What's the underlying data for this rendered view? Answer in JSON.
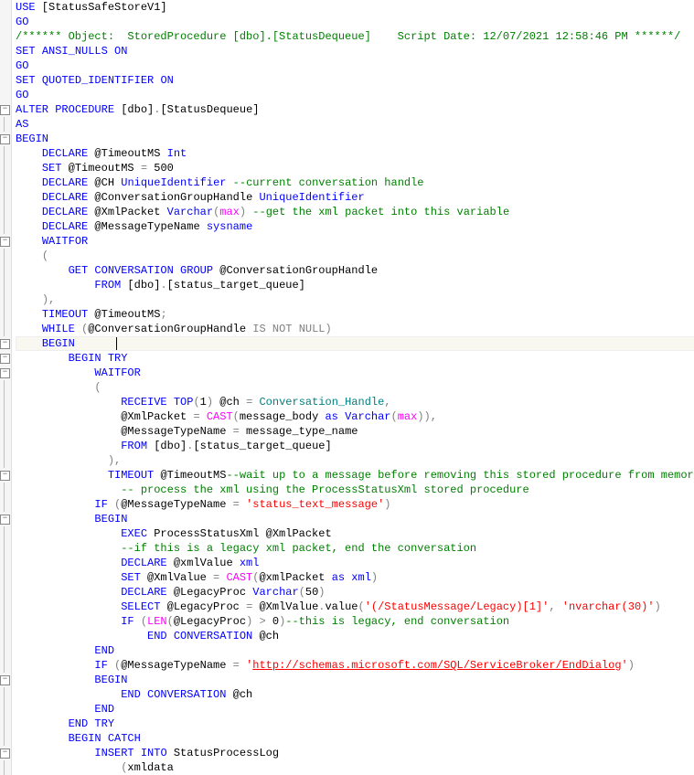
{
  "lines": [
    {
      "fold": "",
      "seg": [
        {
          "c": "kw",
          "t": "USE"
        },
        {
          "c": "txt",
          "t": " [StatusSafeStoreV1]"
        }
      ]
    },
    {
      "fold": "",
      "seg": [
        {
          "c": "kw",
          "t": "GO"
        }
      ]
    },
    {
      "fold": "",
      "seg": [
        {
          "c": "comment",
          "t": "/****** Object:  StoredProcedure [dbo].[StatusDequeue]    Script Date: 12/07/2021 12:58:46 PM ******/"
        }
      ]
    },
    {
      "fold": "",
      "seg": [
        {
          "c": "kw",
          "t": "SET"
        },
        {
          "c": "txt",
          "t": " "
        },
        {
          "c": "kw",
          "t": "ANSI_NULLS"
        },
        {
          "c": "txt",
          "t": " "
        },
        {
          "c": "kw",
          "t": "ON"
        }
      ]
    },
    {
      "fold": "",
      "seg": [
        {
          "c": "kw",
          "t": "GO"
        }
      ]
    },
    {
      "fold": "",
      "seg": [
        {
          "c": "kw",
          "t": "SET"
        },
        {
          "c": "txt",
          "t": " "
        },
        {
          "c": "kw",
          "t": "QUOTED_IDENTIFIER"
        },
        {
          "c": "txt",
          "t": " "
        },
        {
          "c": "kw",
          "t": "ON"
        }
      ]
    },
    {
      "fold": "",
      "seg": [
        {
          "c": "kw",
          "t": "GO"
        }
      ]
    },
    {
      "fold": "−",
      "seg": [
        {
          "c": "kw",
          "t": "ALTER"
        },
        {
          "c": "txt",
          "t": " "
        },
        {
          "c": "kw",
          "t": "PROCEDURE"
        },
        {
          "c": "txt",
          "t": " [dbo]"
        },
        {
          "c": "op",
          "t": "."
        },
        {
          "c": "txt",
          "t": "[StatusDequeue]"
        }
      ]
    },
    {
      "fold": "|",
      "seg": [
        {
          "c": "kw",
          "t": "AS"
        }
      ]
    },
    {
      "fold": "−",
      "seg": [
        {
          "c": "kw",
          "t": "BEGIN"
        }
      ]
    },
    {
      "fold": "|",
      "seg": [
        {
          "c": "txt",
          "t": "    "
        },
        {
          "c": "kw",
          "t": "DECLARE"
        },
        {
          "c": "txt",
          "t": " @TimeoutMS "
        },
        {
          "c": "kw",
          "t": "Int"
        }
      ]
    },
    {
      "fold": "|",
      "seg": [
        {
          "c": "txt",
          "t": "    "
        },
        {
          "c": "kw",
          "t": "SET"
        },
        {
          "c": "txt",
          "t": " @TimeoutMS "
        },
        {
          "c": "op",
          "t": "="
        },
        {
          "c": "txt",
          "t": " 500"
        }
      ]
    },
    {
      "fold": "|",
      "seg": [
        {
          "c": "txt",
          "t": "    "
        },
        {
          "c": "kw",
          "t": "DECLARE"
        },
        {
          "c": "txt",
          "t": " @CH "
        },
        {
          "c": "kw",
          "t": "UniqueIdentifier"
        },
        {
          "c": "txt",
          "t": " "
        },
        {
          "c": "comment",
          "t": "--current conversation handle"
        }
      ]
    },
    {
      "fold": "|",
      "seg": [
        {
          "c": "txt",
          "t": "    "
        },
        {
          "c": "kw",
          "t": "DECLARE"
        },
        {
          "c": "txt",
          "t": " @ConversationGroupHandle "
        },
        {
          "c": "kw",
          "t": "UniqueIdentifier"
        }
      ]
    },
    {
      "fold": "|",
      "seg": [
        {
          "c": "txt",
          "t": "    "
        },
        {
          "c": "kw",
          "t": "DECLARE"
        },
        {
          "c": "txt",
          "t": " @XmlPacket "
        },
        {
          "c": "kw",
          "t": "Varchar"
        },
        {
          "c": "op",
          "t": "("
        },
        {
          "c": "func",
          "t": "max"
        },
        {
          "c": "op",
          "t": ")"
        },
        {
          "c": "txt",
          "t": " "
        },
        {
          "c": "comment",
          "t": "--get the xml packet into this variable"
        }
      ]
    },
    {
      "fold": "|",
      "seg": [
        {
          "c": "txt",
          "t": "    "
        },
        {
          "c": "kw",
          "t": "DECLARE"
        },
        {
          "c": "txt",
          "t": " @MessageTypeName "
        },
        {
          "c": "kw",
          "t": "sysname"
        }
      ]
    },
    {
      "fold": "−",
      "seg": [
        {
          "c": "txt",
          "t": "    "
        },
        {
          "c": "kw",
          "t": "WAITFOR"
        }
      ]
    },
    {
      "fold": "|",
      "seg": [
        {
          "c": "txt",
          "t": "    "
        },
        {
          "c": "op",
          "t": "("
        }
      ]
    },
    {
      "fold": "|",
      "seg": [
        {
          "c": "txt",
          "t": "        "
        },
        {
          "c": "kw",
          "t": "GET"
        },
        {
          "c": "txt",
          "t": " "
        },
        {
          "c": "kw",
          "t": "CONVERSATION"
        },
        {
          "c": "txt",
          "t": " "
        },
        {
          "c": "kw",
          "t": "GROUP"
        },
        {
          "c": "txt",
          "t": " @ConversationGroupHandle"
        }
      ]
    },
    {
      "fold": "|",
      "seg": [
        {
          "c": "txt",
          "t": "            "
        },
        {
          "c": "kw",
          "t": "FROM"
        },
        {
          "c": "txt",
          "t": " [dbo]"
        },
        {
          "c": "op",
          "t": "."
        },
        {
          "c": "txt",
          "t": "[status_target_queue]"
        }
      ]
    },
    {
      "fold": "|",
      "seg": [
        {
          "c": "txt",
          "t": "    "
        },
        {
          "c": "op",
          "t": "),"
        }
      ]
    },
    {
      "fold": "|",
      "seg": [
        {
          "c": "txt",
          "t": "    "
        },
        {
          "c": "kw",
          "t": "TIMEOUT"
        },
        {
          "c": "txt",
          "t": " @TimeoutMS"
        },
        {
          "c": "op",
          "t": ";"
        }
      ]
    },
    {
      "fold": "|",
      "seg": [
        {
          "c": "txt",
          "t": "    "
        },
        {
          "c": "kw",
          "t": "WHILE"
        },
        {
          "c": "txt",
          "t": " "
        },
        {
          "c": "op",
          "t": "("
        },
        {
          "c": "txt",
          "t": "@ConversationGroupHandle "
        },
        {
          "c": "op",
          "t": "IS"
        },
        {
          "c": "txt",
          "t": " "
        },
        {
          "c": "op",
          "t": "NOT"
        },
        {
          "c": "txt",
          "t": " "
        },
        {
          "c": "op",
          "t": "NULL"
        },
        {
          "c": "op",
          "t": ")"
        }
      ]
    },
    {
      "fold": "−",
      "current": true,
      "seg": [
        {
          "c": "txt",
          "t": "    "
        },
        {
          "c": "kw",
          "t": "BEGIN"
        },
        {
          "c": "txt",
          "t": "      "
        }
      ],
      "cursor": true
    },
    {
      "fold": "−",
      "seg": [
        {
          "c": "txt",
          "t": "        "
        },
        {
          "c": "kw",
          "t": "BEGIN"
        },
        {
          "c": "txt",
          "t": " "
        },
        {
          "c": "kw",
          "t": "TRY"
        }
      ]
    },
    {
      "fold": "−",
      "seg": [
        {
          "c": "txt",
          "t": "            "
        },
        {
          "c": "kw",
          "t": "WAITFOR"
        }
      ]
    },
    {
      "fold": "|",
      "seg": [
        {
          "c": "txt",
          "t": "            "
        },
        {
          "c": "op",
          "t": "("
        }
      ]
    },
    {
      "fold": "|",
      "seg": [
        {
          "c": "txt",
          "t": "                "
        },
        {
          "c": "kw",
          "t": "RECEIVE"
        },
        {
          "c": "txt",
          "t": " "
        },
        {
          "c": "kw",
          "t": "TOP"
        },
        {
          "c": "op",
          "t": "("
        },
        {
          "c": "txt",
          "t": "1"
        },
        {
          "c": "op",
          "t": ")"
        },
        {
          "c": "txt",
          "t": " @ch "
        },
        {
          "c": "op",
          "t": "="
        },
        {
          "c": "txt",
          "t": " "
        },
        {
          "c": "ident",
          "t": "Conversation_Handle"
        },
        {
          "c": "op",
          "t": ","
        }
      ]
    },
    {
      "fold": "|",
      "seg": [
        {
          "c": "txt",
          "t": "                @XmlPacket "
        },
        {
          "c": "op",
          "t": "="
        },
        {
          "c": "txt",
          "t": " "
        },
        {
          "c": "func",
          "t": "CAST"
        },
        {
          "c": "op",
          "t": "("
        },
        {
          "c": "txt",
          "t": "message_body "
        },
        {
          "c": "kw",
          "t": "as"
        },
        {
          "c": "txt",
          "t": " "
        },
        {
          "c": "kw",
          "t": "Varchar"
        },
        {
          "c": "op",
          "t": "("
        },
        {
          "c": "func",
          "t": "max"
        },
        {
          "c": "op",
          "t": ")),"
        }
      ]
    },
    {
      "fold": "|",
      "seg": [
        {
          "c": "txt",
          "t": "                @MessageTypeName "
        },
        {
          "c": "op",
          "t": "="
        },
        {
          "c": "txt",
          "t": " message_type_name"
        }
      ]
    },
    {
      "fold": "|",
      "seg": [
        {
          "c": "txt",
          "t": "                "
        },
        {
          "c": "kw",
          "t": "FROM"
        },
        {
          "c": "txt",
          "t": " [dbo]"
        },
        {
          "c": "op",
          "t": "."
        },
        {
          "c": "txt",
          "t": "[status_target_queue]"
        }
      ]
    },
    {
      "fold": "|",
      "seg": [
        {
          "c": "txt",
          "t": "              "
        },
        {
          "c": "op",
          "t": "),"
        }
      ]
    },
    {
      "fold": "−",
      "seg": [
        {
          "c": "txt",
          "t": "              "
        },
        {
          "c": "kw",
          "t": "TIMEOUT"
        },
        {
          "c": "txt",
          "t": " @TimeoutMS"
        },
        {
          "c": "comment",
          "t": "--wait up to a message before removing this stored procedure from memory"
        }
      ]
    },
    {
      "fold": "|",
      "seg": [
        {
          "c": "txt",
          "t": "                "
        },
        {
          "c": "comment",
          "t": "-- process the xml using the ProcessStatusXml stored procedure"
        }
      ]
    },
    {
      "fold": "|",
      "seg": [
        {
          "c": "txt",
          "t": "            "
        },
        {
          "c": "kw",
          "t": "IF"
        },
        {
          "c": "txt",
          "t": " "
        },
        {
          "c": "op",
          "t": "("
        },
        {
          "c": "txt",
          "t": "@MessageTypeName "
        },
        {
          "c": "op",
          "t": "="
        },
        {
          "c": "txt",
          "t": " "
        },
        {
          "c": "str",
          "t": "'status_text_message'"
        },
        {
          "c": "op",
          "t": ")"
        }
      ]
    },
    {
      "fold": "−",
      "seg": [
        {
          "c": "txt",
          "t": "            "
        },
        {
          "c": "kw",
          "t": "BEGIN"
        }
      ]
    },
    {
      "fold": "|",
      "seg": [
        {
          "c": "txt",
          "t": "                "
        },
        {
          "c": "kw",
          "t": "EXEC"
        },
        {
          "c": "txt",
          "t": " ProcessStatusXml @XmlPacket"
        }
      ]
    },
    {
      "fold": "|",
      "seg": [
        {
          "c": "txt",
          "t": "                "
        },
        {
          "c": "comment",
          "t": "--if this is a legacy xml packet, end the conversation"
        }
      ]
    },
    {
      "fold": "|",
      "seg": [
        {
          "c": "txt",
          "t": "                "
        },
        {
          "c": "kw",
          "t": "DECLARE"
        },
        {
          "c": "txt",
          "t": " @xmlValue "
        },
        {
          "c": "kw",
          "t": "xml"
        }
      ]
    },
    {
      "fold": "|",
      "seg": [
        {
          "c": "txt",
          "t": "                "
        },
        {
          "c": "kw",
          "t": "SET"
        },
        {
          "c": "txt",
          "t": " @XmlValue "
        },
        {
          "c": "op",
          "t": "="
        },
        {
          "c": "txt",
          "t": " "
        },
        {
          "c": "func",
          "t": "CAST"
        },
        {
          "c": "op",
          "t": "("
        },
        {
          "c": "txt",
          "t": "@xmlPacket "
        },
        {
          "c": "kw",
          "t": "as"
        },
        {
          "c": "txt",
          "t": " "
        },
        {
          "c": "kw",
          "t": "xml"
        },
        {
          "c": "op",
          "t": ")"
        }
      ]
    },
    {
      "fold": "|",
      "seg": [
        {
          "c": "txt",
          "t": "                "
        },
        {
          "c": "kw",
          "t": "DECLARE"
        },
        {
          "c": "txt",
          "t": " @LegacyProc "
        },
        {
          "c": "kw",
          "t": "Varchar"
        },
        {
          "c": "op",
          "t": "("
        },
        {
          "c": "txt",
          "t": "50"
        },
        {
          "c": "op",
          "t": ")"
        }
      ]
    },
    {
      "fold": "|",
      "seg": [
        {
          "c": "txt",
          "t": "                "
        },
        {
          "c": "kw",
          "t": "SELECT"
        },
        {
          "c": "txt",
          "t": " @LegacyProc "
        },
        {
          "c": "op",
          "t": "="
        },
        {
          "c": "txt",
          "t": " @XmlValue"
        },
        {
          "c": "op",
          "t": "."
        },
        {
          "c": "txt",
          "t": "value"
        },
        {
          "c": "op",
          "t": "("
        },
        {
          "c": "str",
          "t": "'(/StatusMessage/Legacy)[1]'"
        },
        {
          "c": "op",
          "t": ","
        },
        {
          "c": "txt",
          "t": " "
        },
        {
          "c": "str",
          "t": "'nvarchar(30)'"
        },
        {
          "c": "op",
          "t": ")"
        }
      ]
    },
    {
      "fold": "|",
      "seg": [
        {
          "c": "txt",
          "t": "                "
        },
        {
          "c": "kw",
          "t": "IF"
        },
        {
          "c": "txt",
          "t": " "
        },
        {
          "c": "op",
          "t": "("
        },
        {
          "c": "func",
          "t": "LEN"
        },
        {
          "c": "op",
          "t": "("
        },
        {
          "c": "txt",
          "t": "@LegacyProc"
        },
        {
          "c": "op",
          "t": ")"
        },
        {
          "c": "txt",
          "t": " "
        },
        {
          "c": "op",
          "t": ">"
        },
        {
          "c": "txt",
          "t": " 0"
        },
        {
          "c": "op",
          "t": ")"
        },
        {
          "c": "comment",
          "t": "--this is legacy, end conversation"
        }
      ]
    },
    {
      "fold": "|",
      "seg": [
        {
          "c": "txt",
          "t": "                    "
        },
        {
          "c": "kw",
          "t": "END"
        },
        {
          "c": "txt",
          "t": " "
        },
        {
          "c": "kw",
          "t": "CONVERSATION"
        },
        {
          "c": "txt",
          "t": " @ch"
        }
      ]
    },
    {
      "fold": "|",
      "seg": [
        {
          "c": "txt",
          "t": "            "
        },
        {
          "c": "kw",
          "t": "END"
        }
      ]
    },
    {
      "fold": "|",
      "seg": [
        {
          "c": "txt",
          "t": "            "
        },
        {
          "c": "kw",
          "t": "IF"
        },
        {
          "c": "txt",
          "t": " "
        },
        {
          "c": "op",
          "t": "("
        },
        {
          "c": "txt",
          "t": "@MessageTypeName "
        },
        {
          "c": "op",
          "t": "="
        },
        {
          "c": "txt",
          "t": " "
        },
        {
          "c": "str",
          "t": "'"
        },
        {
          "c": "strlink",
          "t": "http://schemas.microsoft.com/SQL/ServiceBroker/EndDialog"
        },
        {
          "c": "str",
          "t": "'"
        },
        {
          "c": "op",
          "t": ")"
        }
      ]
    },
    {
      "fold": "−",
      "seg": [
        {
          "c": "txt",
          "t": "            "
        },
        {
          "c": "kw",
          "t": "BEGIN"
        }
      ]
    },
    {
      "fold": "|",
      "seg": [
        {
          "c": "txt",
          "t": "                "
        },
        {
          "c": "kw",
          "t": "END"
        },
        {
          "c": "txt",
          "t": " "
        },
        {
          "c": "kw",
          "t": "CONVERSATION"
        },
        {
          "c": "txt",
          "t": " @ch"
        }
      ]
    },
    {
      "fold": "|",
      "seg": [
        {
          "c": "txt",
          "t": "            "
        },
        {
          "c": "kw",
          "t": "END"
        }
      ]
    },
    {
      "fold": "|",
      "seg": [
        {
          "c": "txt",
          "t": "        "
        },
        {
          "c": "kw",
          "t": "END"
        },
        {
          "c": "txt",
          "t": " "
        },
        {
          "c": "kw",
          "t": "TRY"
        }
      ]
    },
    {
      "fold": "|",
      "seg": [
        {
          "c": "txt",
          "t": "        "
        },
        {
          "c": "kw",
          "t": "BEGIN"
        },
        {
          "c": "txt",
          "t": " "
        },
        {
          "c": "kw",
          "t": "CATCH"
        }
      ]
    },
    {
      "fold": "−",
      "seg": [
        {
          "c": "txt",
          "t": "            "
        },
        {
          "c": "kw",
          "t": "INSERT"
        },
        {
          "c": "txt",
          "t": " "
        },
        {
          "c": "kw",
          "t": "INTO"
        },
        {
          "c": "txt",
          "t": " StatusProcessLog"
        }
      ]
    },
    {
      "fold": "|",
      "seg": [
        {
          "c": "txt",
          "t": "                "
        },
        {
          "c": "op",
          "t": "("
        },
        {
          "c": "txt",
          "t": "xmldata"
        }
      ]
    }
  ]
}
